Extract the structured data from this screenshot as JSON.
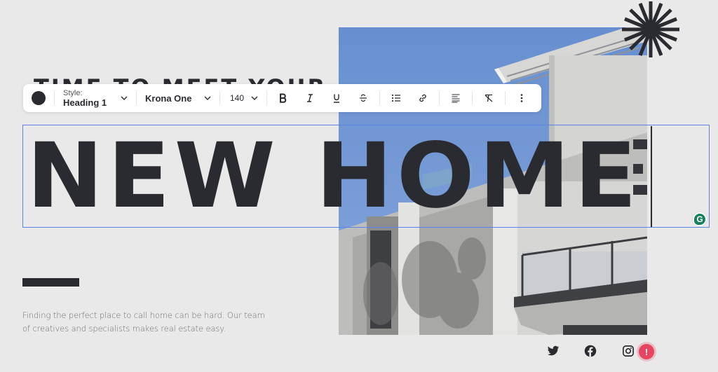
{
  "page": {
    "pre_heading": "TIME TO MEET YOUR",
    "heading": "NEW HOME",
    "tagline": "Finding the perfect place to call home can be hard. Our team of creatives and specialists makes real estate easy."
  },
  "toolbar": {
    "text_color": "#2a2b30",
    "style_label": "Style:",
    "style_value": "Heading 1",
    "font_value": "Krona One",
    "size_value": "140",
    "buttons": [
      {
        "name": "bold",
        "icon": "bold-icon"
      },
      {
        "name": "italic",
        "icon": "italic-icon"
      },
      {
        "name": "underline",
        "icon": "underline-icon"
      },
      {
        "name": "strikethrough",
        "icon": "strikethrough-icon"
      },
      {
        "name": "bulleted-list",
        "icon": "list-icon"
      },
      {
        "name": "link",
        "icon": "link-icon"
      },
      {
        "name": "align",
        "icon": "align-left-icon"
      },
      {
        "name": "clear-format",
        "icon": "clear-format-icon"
      },
      {
        "name": "more",
        "icon": "more-vertical-icon"
      }
    ]
  },
  "badges": {
    "grammarly": "G",
    "alert": "!"
  },
  "social": [
    "twitter",
    "facebook",
    "instagram"
  ],
  "colors": {
    "background": "#e9e9e9",
    "text_dark": "#2a2b30",
    "selection_border": "#5b84e8",
    "sky": "#6f96d3",
    "alert": "#e8435f",
    "grammarly": "#15805a"
  }
}
